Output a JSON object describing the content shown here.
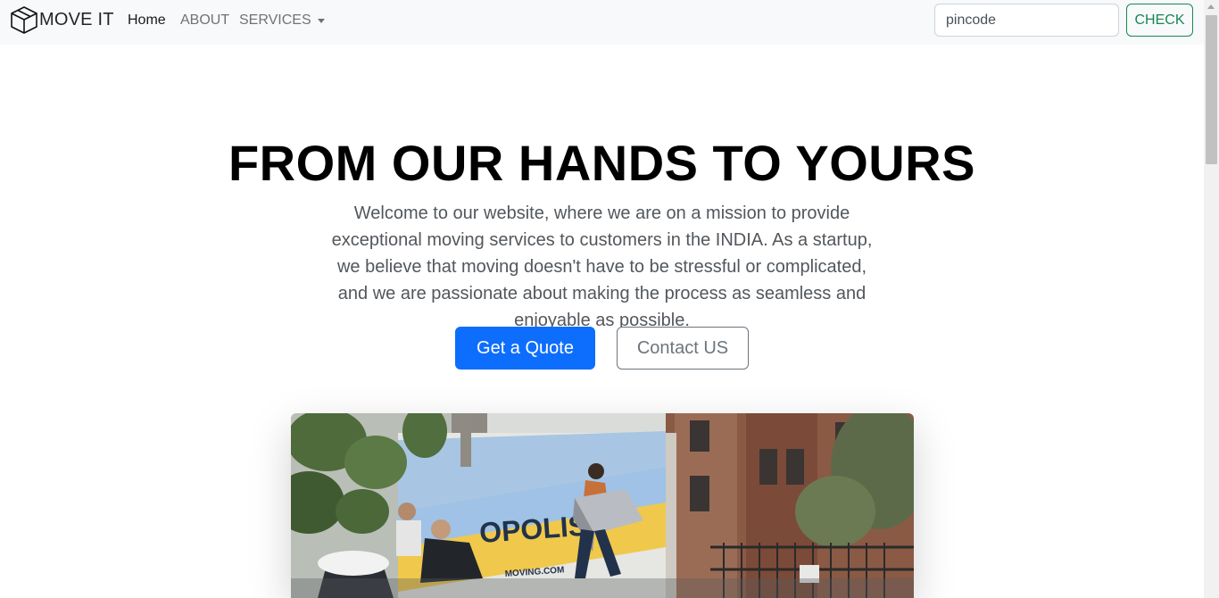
{
  "navbar": {
    "brand": "MOVE IT",
    "brand_icon": "box-icon",
    "links": {
      "home": "Home",
      "about": "ABOUT",
      "services": "SERVICES"
    },
    "search": {
      "placeholder": "pincode"
    },
    "check_label": "CHECK"
  },
  "hero": {
    "title": "FROM OUR HANDS TO YOURS",
    "text": "Welcome to our website, where we are on a mission to provide exceptional moving services to customers in the INDIA. As a startup, we believe that moving doesn't have to be stressful or complicated, and we are passionate about making the process as seamless and enjoyable as possible.",
    "quote_label": "Get a Quote",
    "contact_label": "Contact US",
    "image_sign": "OPOLIS",
    "image_sign_sub": "MOVING.COM"
  },
  "colors": {
    "primary": "#0d6efd",
    "success": "#198754",
    "secondary": "#6c757d",
    "navbar_bg": "#f8f9fa"
  }
}
